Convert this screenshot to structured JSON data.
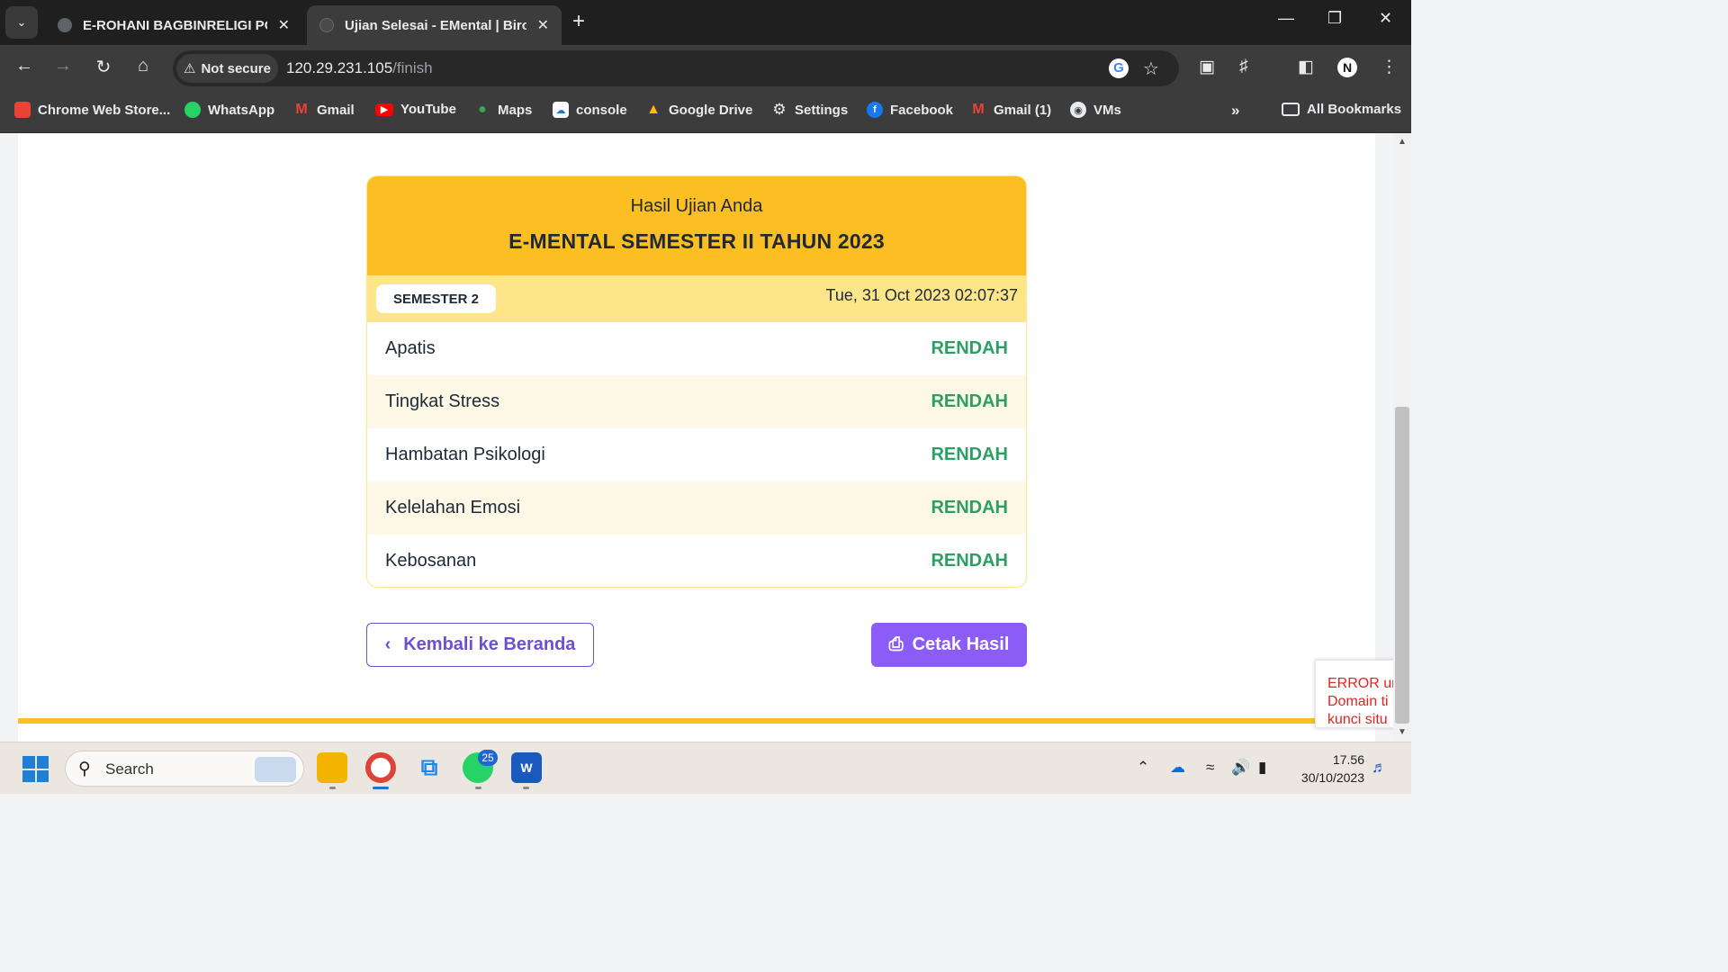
{
  "browser": {
    "tabs": [
      {
        "title": "E-ROHANI BAGBINRELIGI POLRI",
        "active": false
      },
      {
        "title": "Ujian Selesai - EMental | Biro Psikologi",
        "active": true
      }
    ],
    "security_label": "Not secure",
    "url_host": "120.29.231.105",
    "url_path": "/finish",
    "bookmarks": [
      {
        "label": "Chrome Web Store...",
        "icon": "chrome-web-store-icon"
      },
      {
        "label": "WhatsApp",
        "icon": "whatsapp-icon"
      },
      {
        "label": "Gmail",
        "icon": "gmail-icon"
      },
      {
        "label": "YouTube",
        "icon": "youtube-icon"
      },
      {
        "label": "Maps",
        "icon": "maps-icon"
      },
      {
        "label": "console",
        "icon": "console-icon"
      },
      {
        "label": "Google Drive",
        "icon": "google-drive-icon"
      },
      {
        "label": "Settings",
        "icon": "gear-icon"
      },
      {
        "label": "Facebook",
        "icon": "facebook-icon"
      },
      {
        "label": "Gmail (1)",
        "icon": "gmail-icon"
      },
      {
        "label": "VMs",
        "icon": "globe-icon"
      }
    ],
    "all_bookmarks_label": "All Bookmarks"
  },
  "result": {
    "subtitle": "Hasil Ujian Anda",
    "title": "E-MENTAL SEMESTER II TAHUN 2023",
    "semester_badge": "SEMESTER 2",
    "timestamp": "Tue, 31 Oct 2023 02:07:37",
    "rows": [
      {
        "label": "Apatis",
        "value": "RENDAH"
      },
      {
        "label": "Tingkat Stress",
        "value": "RENDAH"
      },
      {
        "label": "Hambatan Psikologi",
        "value": "RENDAH"
      },
      {
        "label": "Kelelahan Emosi",
        "value": "RENDAH"
      },
      {
        "label": "Kebosanan",
        "value": "RENDAH"
      }
    ]
  },
  "actions": {
    "back_label": "Kembali ke Beranda",
    "print_label": "Cetak Hasil"
  },
  "error_popup": {
    "line1": "ERROR ur",
    "line2": "Domain ti",
    "line3": "kunci situ"
  },
  "taskbar": {
    "search_label": "Search",
    "whatsapp_badge": "25",
    "time": "17.56",
    "date": "30/10/2023"
  },
  "colors": {
    "accent_yellow": "#fbbf24",
    "accent_purple": "#8b5cf6",
    "status_green": "#2f9e63"
  }
}
